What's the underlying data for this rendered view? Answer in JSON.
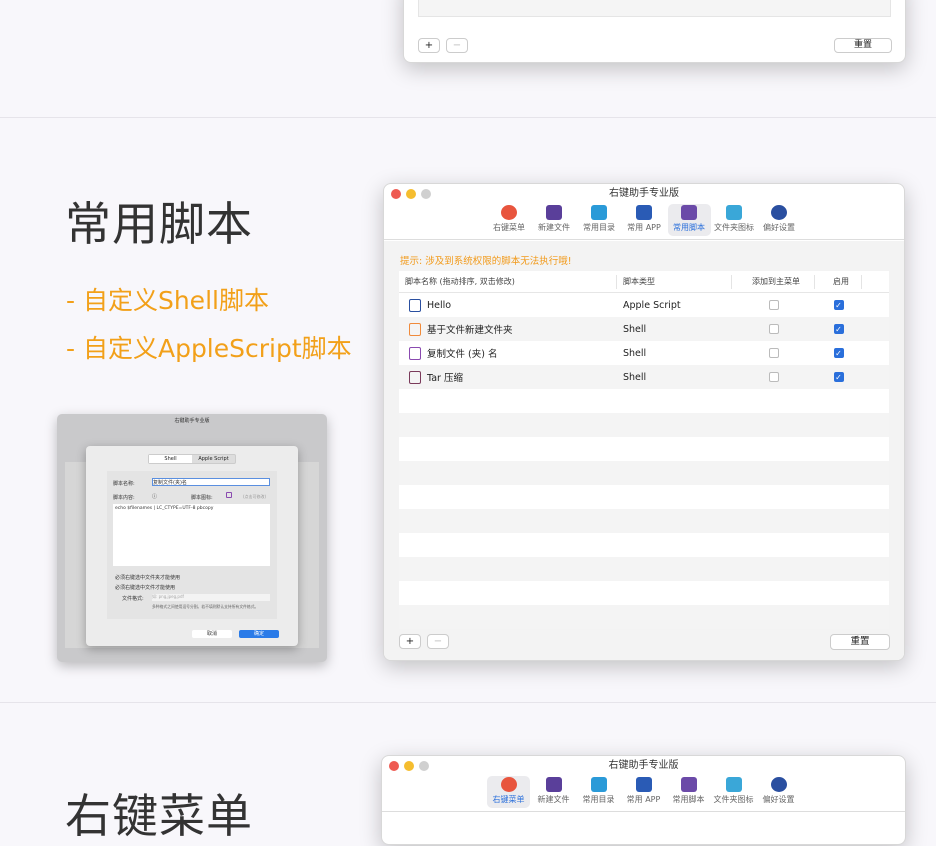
{
  "top_window": {
    "add": "+",
    "remove": "−",
    "reset": "重置"
  },
  "section": {
    "heading": "常用脚本",
    "bullets": [
      "- 自定义Shell脚本",
      "- 自定义AppleScript脚本"
    ]
  },
  "window": {
    "title": "右键助手专业版",
    "toolbar": [
      {
        "label": "右键菜单",
        "icon": "list-icon",
        "color": "#e8553e"
      },
      {
        "label": "新建文件",
        "icon": "new-file-icon",
        "color": "#5a3f9a"
      },
      {
        "label": "常用目录",
        "icon": "folder-star-icon",
        "color": "#2a9ad8"
      },
      {
        "label": "常用 APP",
        "icon": "app-store-icon",
        "color": "#2a5bb5"
      },
      {
        "label": "常用脚本",
        "icon": "script-icon",
        "color": "#6b4aa8"
      },
      {
        "label": "文件夹图标",
        "icon": "folder-heart-icon",
        "color": "#3aa7d8"
      },
      {
        "label": "偏好设置",
        "icon": "gear-icon",
        "color": "#2a4fa0"
      }
    ],
    "selected_tab": 4,
    "hint": "提示: 涉及到系统权限的脚本无法执行哦!",
    "columns": [
      "脚本名称 (拖动排序, 双击修改)",
      "脚本类型",
      "添加到主菜单",
      "启用"
    ],
    "rows": [
      {
        "name": "Hello",
        "type": "Apple Script",
        "main": false,
        "enabled": true,
        "color": "#2a4fa0"
      },
      {
        "name": "基于文件新建文件夹",
        "type": "Shell",
        "main": false,
        "enabled": true,
        "color": "#f08a3a"
      },
      {
        "name": "复制文件 (夹) 名",
        "type": "Shell",
        "main": false,
        "enabled": true,
        "color": "#8a4ab0"
      },
      {
        "name": "Tar 压缩",
        "type": "Shell",
        "main": false,
        "enabled": true,
        "color": "#7a3a5a"
      }
    ],
    "add": "+",
    "remove": "−",
    "reset": "重置"
  },
  "mini": {
    "title": "右键助手专业版",
    "seg": [
      "Shell",
      "Apple Script"
    ],
    "name_label": "脚本名称:",
    "name_value": "复制文件(夹)名",
    "content_label": "脚本内容:",
    "icon_label": "脚本图标:",
    "icon_hint": "(点击可修改)",
    "code": "echo $filenames | LC_CTYPE=UTF-8 pbcopy",
    "opt1": "必须右键选中文件夹才能使用",
    "opt2": "必须右键选中文件才能使用",
    "format_label": "文件格式:",
    "format_placeholder": "如: png,jpeg,pdf",
    "format_note": "多种格式之间使用逗号分割。若不填则默认支持所有文件格式。",
    "cancel": "取消",
    "ok": "确定"
  },
  "bottom_window": {
    "title": "右键助手专业版",
    "selected_tab": 0
  },
  "bottom_heading": "右键菜单"
}
